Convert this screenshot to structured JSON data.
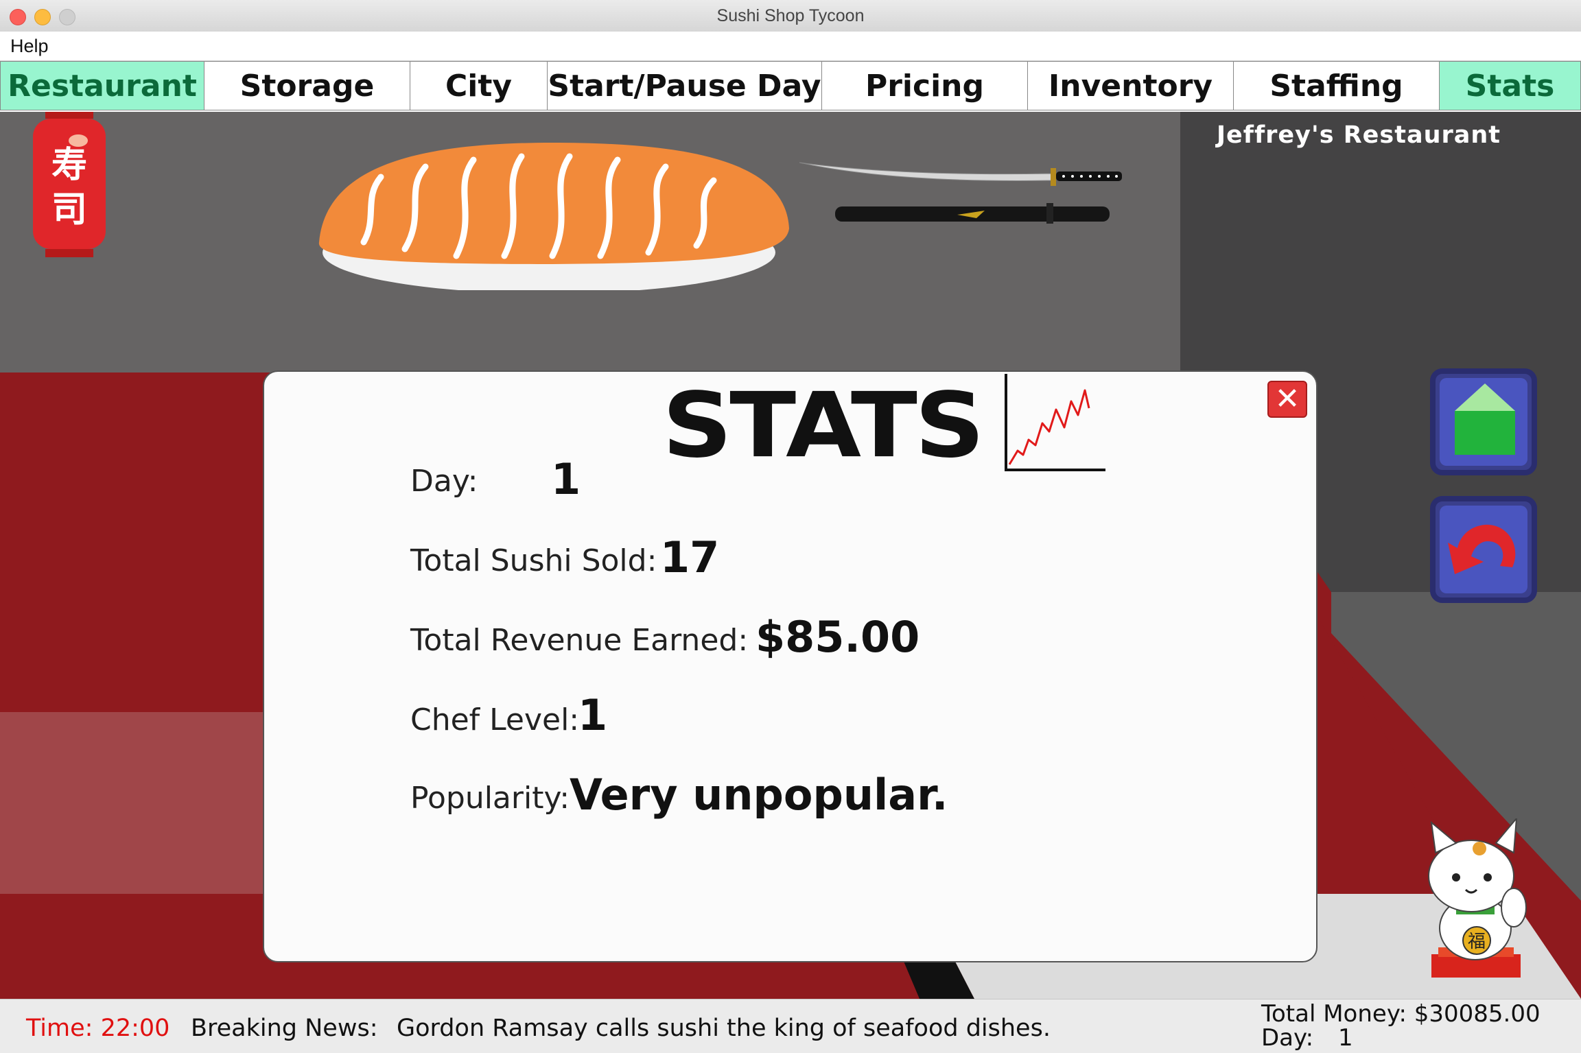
{
  "window": {
    "title": "Sushi Shop Tycoon"
  },
  "menu": {
    "help": "Help"
  },
  "tabs": [
    {
      "label": "Restaurant",
      "active": true
    },
    {
      "label": "Storage",
      "active": false
    },
    {
      "label": "City",
      "active": false
    },
    {
      "label": "Start/Pause Day",
      "active": false
    },
    {
      "label": "Pricing",
      "active": false
    },
    {
      "label": "Inventory",
      "active": false
    },
    {
      "label": "Staffing",
      "active": false
    },
    {
      "label": "Stats",
      "active": true
    }
  ],
  "restaurant": {
    "name": "Jeffrey's Restaurant",
    "lantern_text": "寿司",
    "lucky_cat_text": "福"
  },
  "stats_modal": {
    "title": "STATS",
    "close_glyph": "✕",
    "rows": [
      {
        "label": "Day:",
        "value": "1"
      },
      {
        "label": "Total Sushi Sold:",
        "value": "17"
      },
      {
        "label": "Total Revenue Earned:",
        "value": "$85.00"
      },
      {
        "label": "Chef Level:",
        "value": "1"
      },
      {
        "label": "Popularity:",
        "value": "Very unpopular."
      }
    ]
  },
  "side_buttons": {
    "up_icon": "house-arrow-icon",
    "undo_icon": "undo-arrow-icon"
  },
  "status": {
    "time": "Time: 22:00",
    "news_label": "Breaking News:",
    "news_text": "Gordon Ramsay calls sushi the king of seafood dishes.",
    "money": "Total Money: $30085.00",
    "day_label": "Day:",
    "day_value": "1"
  },
  "colors": {
    "tab_active_bg": "#98f5cf",
    "tab_active_text": "#0b6a3a",
    "floor_red": "#8f1a1e",
    "time_red": "#e01010",
    "button_blue": "#4a55bf"
  }
}
